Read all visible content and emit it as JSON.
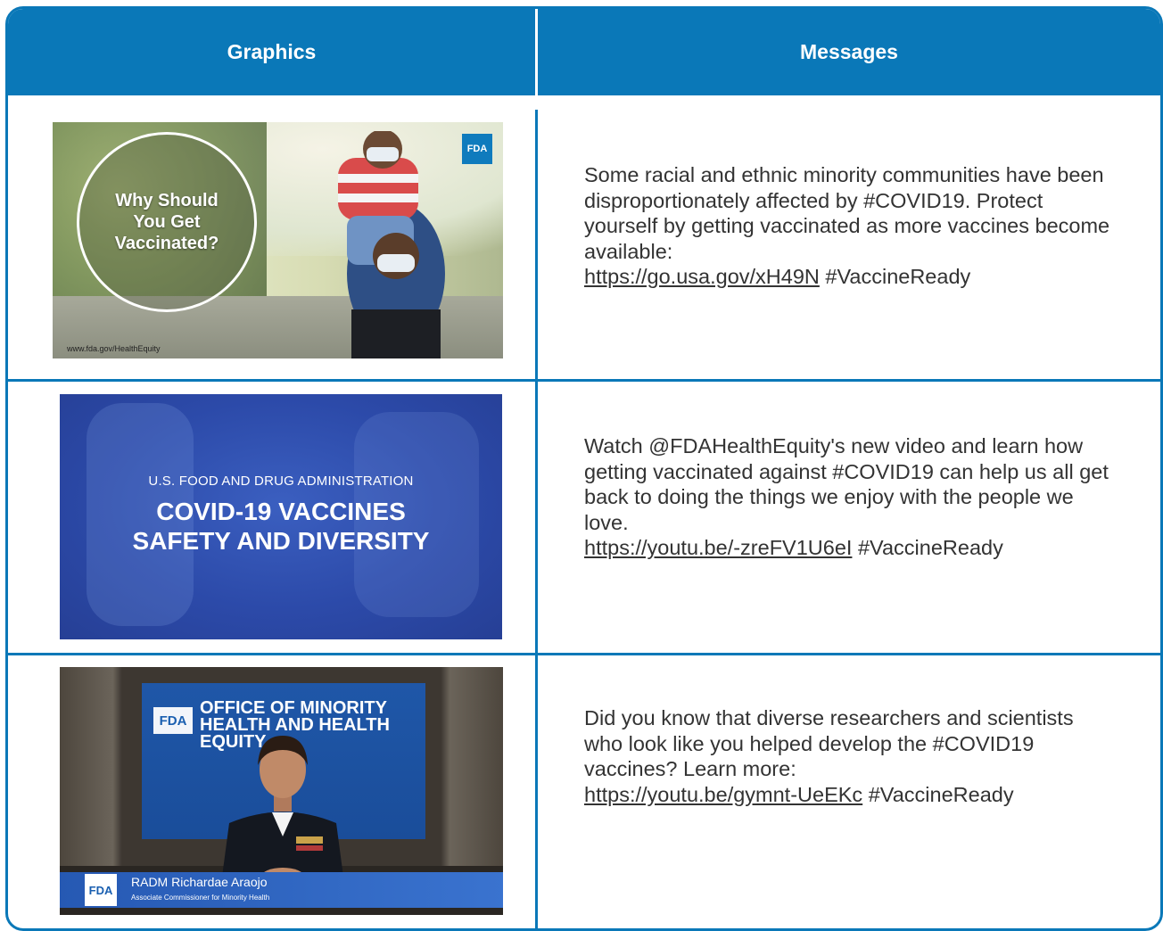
{
  "header": {
    "graphics_label": "Graphics",
    "messages_label": "Messages"
  },
  "rows": [
    {
      "image": {
        "headline": "Why Should You Get Vaccinated?",
        "badge": "FDA",
        "url_text": "www.fda.gov/HealthEquity"
      },
      "message": {
        "text": "Some racial and ethnic minority communities have been disproportionately affected by #COVID19. Protect yourself by getting vaccinated as more vaccines become available:",
        "link": "https://go.usa.gov/xH49N",
        "suffix": "#VaccineReady"
      }
    },
    {
      "image": {
        "line1": "U.S. FOOD AND DRUG ADMINISTRATION",
        "line2": "COVID-19 VACCINES",
        "line3": "SAFETY AND DIVERSITY"
      },
      "message": {
        "text": "Watch @FDAHealthEquity's new video and learn how getting vaccinated against #COVID19 can help us all get back to doing the things we enjoy with the people we love.",
        "link": "https://youtu.be/-zreFV1U6eI",
        "suffix": "#VaccineReady"
      }
    },
    {
      "image": {
        "badge": "FDA",
        "screen_title": "OFFICE OF MINORITY HEALTH AND HEALTH EQUITY",
        "lower_third_name": "RADM Richardae Araojo",
        "lower_third_title": "Associate Commissioner for Minority Health"
      },
      "message": {
        "text": "Did you know that diverse researchers and scientists who look like you helped develop the #COVID19 vaccines? Learn more:",
        "link": "https://youtu.be/gymnt-UeEKc",
        "suffix": "#VaccineReady"
      }
    }
  ],
  "colors": {
    "accent": "#0a78b8",
    "text": "#333333"
  }
}
